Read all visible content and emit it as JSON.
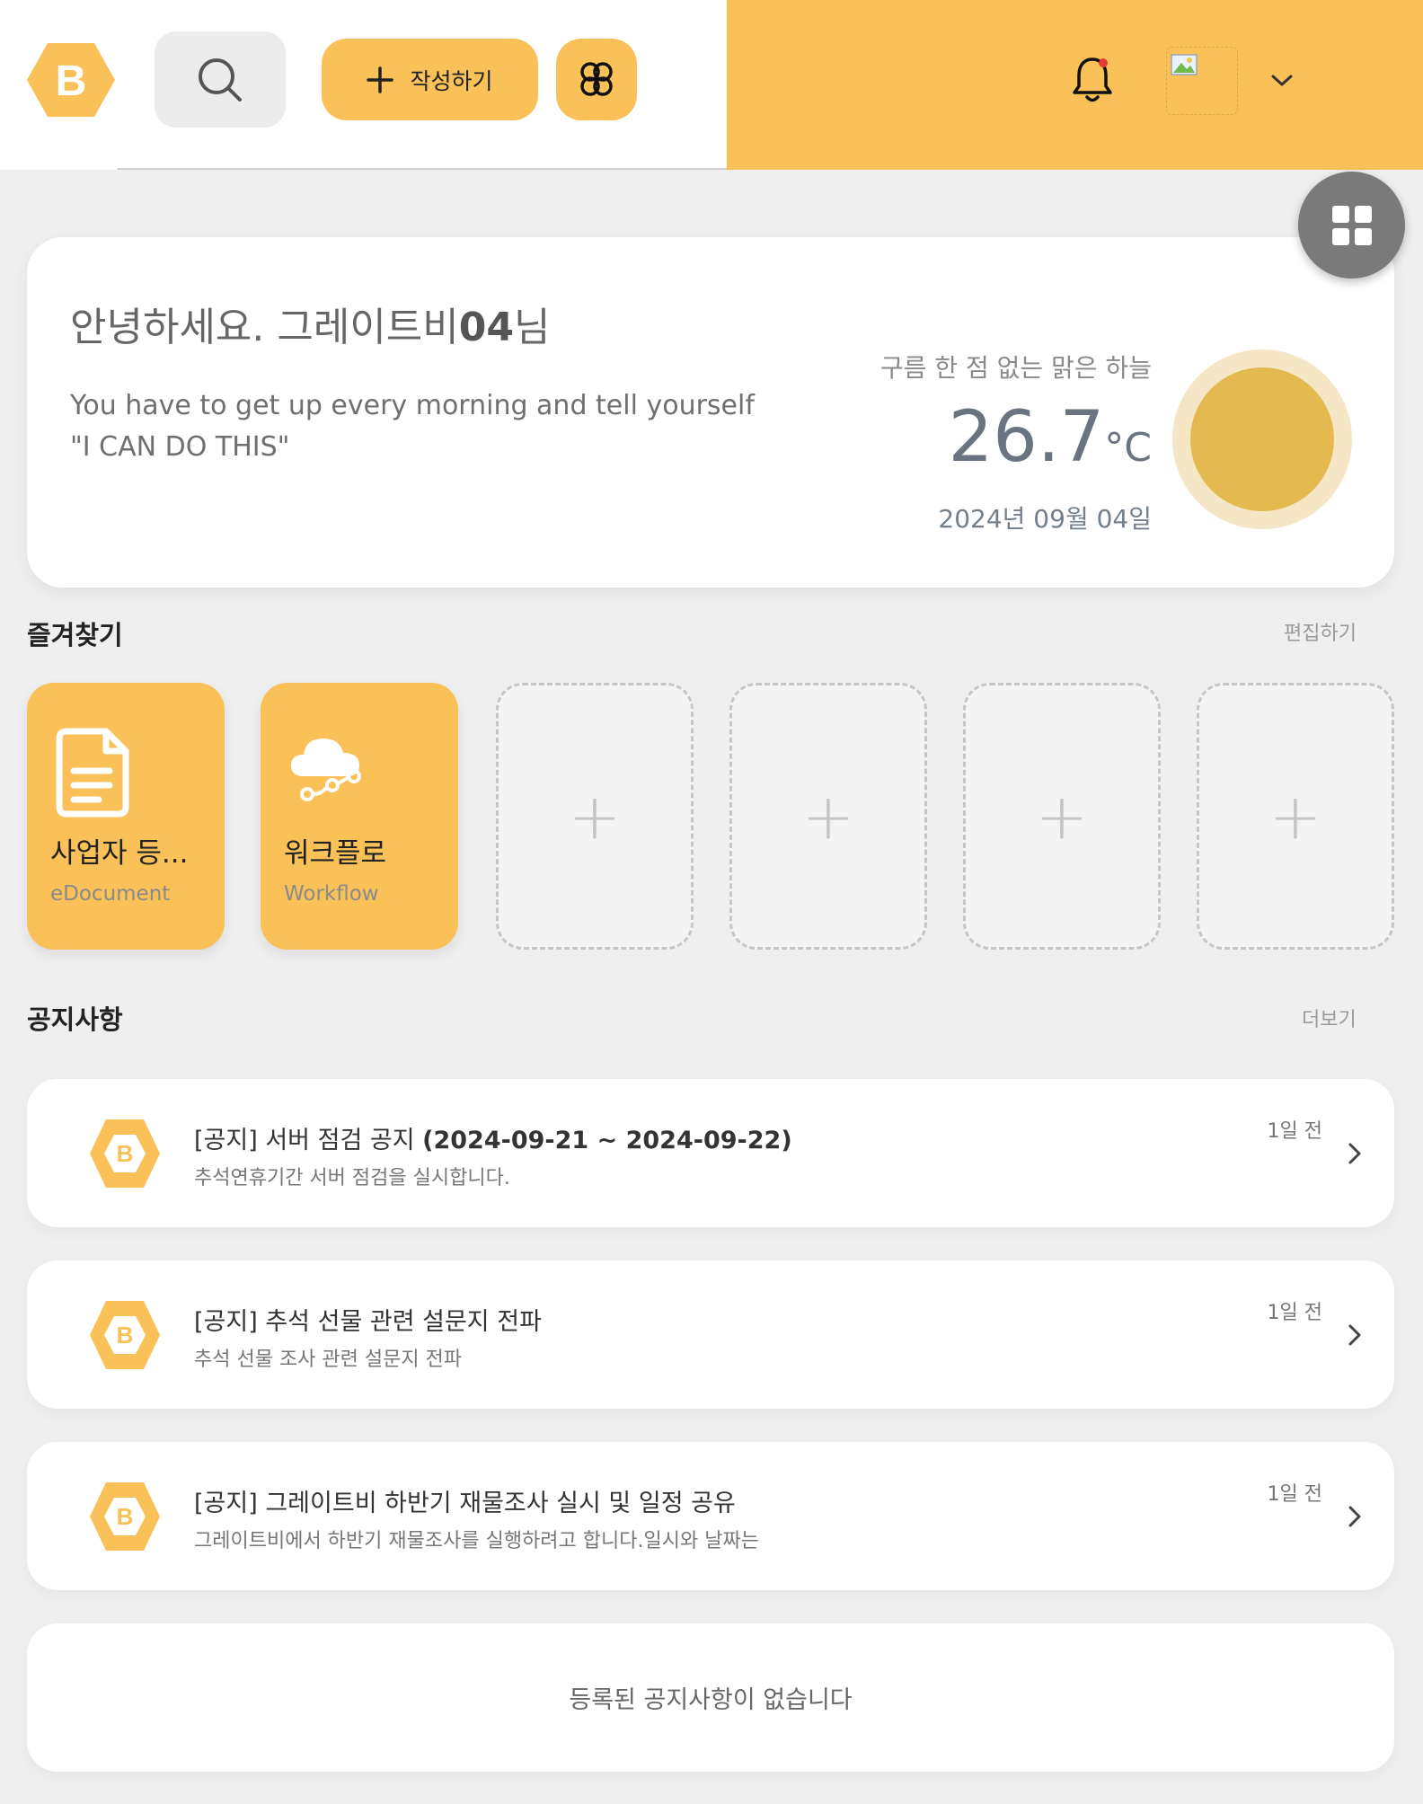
{
  "header": {
    "logo_letter": "B",
    "write_label": "작성하기",
    "icons": {
      "search": "search-icon",
      "plus": "plus-icon",
      "apps": "apps-hex-icon",
      "bell": "bell-icon",
      "avatar": "avatar-image",
      "chevron": "chevron-down-icon",
      "grid": "grid-icon"
    },
    "colors": {
      "accent": "#f9c157",
      "notification_dot": "#e53935"
    }
  },
  "greeting": {
    "title_prefix": "안녕하세요. 그레이트비",
    "title_bold": "04",
    "title_suffix": "님",
    "quote": "You have to get up every morning and tell yourself \"I CAN DO THIS\"",
    "weather_desc": "구름 한 점 없는 맑은 하늘",
    "temp_value": "26.7",
    "temp_unit": "°C",
    "date": "2024년 09월 04일",
    "weather_icon": "sun-icon"
  },
  "favorites": {
    "title": "즐겨찾기",
    "edit_label": "편집하기",
    "items": [
      {
        "name": "사업자 등...",
        "sub": "eDocument",
        "icon": "document-icon"
      },
      {
        "name": "워크플로",
        "sub": "Workflow",
        "icon": "cloud-workflow-icon"
      }
    ],
    "empty_plus": "+"
  },
  "notices": {
    "title": "공지사항",
    "more_label": "더보기",
    "badge_letter": "B",
    "items": [
      {
        "prefix": "[공지] ",
        "title": "서버 점검 공지 ",
        "title_bold": "(2024-09-21 ~ 2024-09-22)",
        "body": "추석연휴기간 서버 점검을 실시합니다.",
        "time": "1일 전"
      },
      {
        "prefix": "[공지] ",
        "title": "추석 선물 관련 설문지 전파",
        "title_bold": "",
        "body": "추석 선물 조사 관련 설문지 전파",
        "time": "1일 전"
      },
      {
        "prefix": "[공지] ",
        "title": "그레이트비 하반기 재물조사 실시 및 일정 공유",
        "title_bold": "",
        "body": "그레이트비에서 하반기 재물조사를 실행하려고 합니다.일시와 날짜는",
        "time": "1일 전"
      }
    ],
    "empty_text": "등록된 공지사항이 없습니다"
  }
}
